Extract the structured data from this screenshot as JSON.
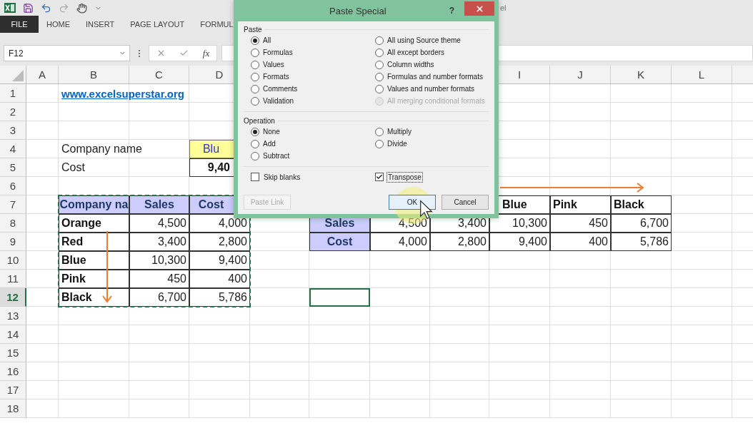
{
  "title_bar": {
    "title_fragment": "el"
  },
  "ribbon_tabs": [
    {
      "label": "FILE",
      "kind": "file"
    },
    {
      "label": "HOME",
      "kind": "tab"
    },
    {
      "label": "INSERT",
      "kind": "tab"
    },
    {
      "label": "PAGE LAYOUT",
      "kind": "tab"
    },
    {
      "label": "FORMUL",
      "kind": "tab"
    }
  ],
  "formula_bar": {
    "name_box": "F12",
    "function_label": "fx"
  },
  "sheet": {
    "columns": [
      "A",
      "B",
      "C",
      "D",
      null,
      null,
      null,
      null,
      "I",
      "J",
      "K",
      "L"
    ],
    "rows": [
      {
        "header": "1",
        "selected": false,
        "cells": [
          null,
          {
            "text": "www.excelsuperstar.org",
            "kind": "link"
          }
        ]
      },
      {
        "header": "2",
        "selected": false,
        "cells": []
      },
      {
        "header": "3",
        "selected": false,
        "cells": []
      },
      {
        "header": "4",
        "selected": false,
        "cells": [
          null,
          {
            "text": "Company name",
            "kind": "label"
          },
          null,
          {
            "text": "Blu",
            "kind": "input"
          }
        ]
      },
      {
        "header": "5",
        "selected": false,
        "cells": [
          null,
          {
            "text": "Cost",
            "kind": "label"
          },
          null,
          {
            "text": "9,40",
            "kind": "total"
          }
        ]
      },
      {
        "header": "6",
        "selected": false,
        "cells": []
      },
      {
        "header": "7",
        "selected": false,
        "cells": [
          null,
          {
            "text": "Company na",
            "kind": "header",
            "copied": true
          },
          {
            "text": "Sales",
            "kind": "header",
            "copied": true
          },
          {
            "text": "Cost",
            "kind": "header",
            "copied": true
          },
          null,
          null,
          null,
          null,
          {
            "text": "Blue",
            "kind": "name"
          },
          {
            "text": "Pink",
            "kind": "name"
          },
          {
            "text": "Black",
            "kind": "name"
          }
        ]
      },
      {
        "header": "8",
        "selected": false,
        "cells": [
          null,
          {
            "text": "Orange",
            "kind": "name",
            "copied": true
          },
          {
            "text": "4,500",
            "kind": "number",
            "copied": true
          },
          {
            "text": "4,000",
            "kind": "number",
            "copied": true
          },
          null,
          {
            "text": "Sales",
            "kind": "header"
          },
          {
            "text": "4,500",
            "kind": "number"
          },
          {
            "text": "3,400",
            "kind": "number"
          },
          {
            "text": "10,300",
            "kind": "number"
          },
          {
            "text": "450",
            "kind": "number"
          },
          {
            "text": "6,700",
            "kind": "number"
          }
        ]
      },
      {
        "header": "9",
        "selected": false,
        "cells": [
          null,
          {
            "text": "Red",
            "kind": "name",
            "copied": true
          },
          {
            "text": "3,400",
            "kind": "number",
            "copied": true
          },
          {
            "text": "2,800",
            "kind": "number",
            "copied": true
          },
          null,
          {
            "text": "Cost",
            "kind": "header"
          },
          {
            "text": "4,000",
            "kind": "number"
          },
          {
            "text": "2,800",
            "kind": "number"
          },
          {
            "text": "9,400",
            "kind": "number"
          },
          {
            "text": "400",
            "kind": "number"
          },
          {
            "text": "5,786",
            "kind": "number"
          }
        ]
      },
      {
        "header": "10",
        "selected": false,
        "cells": [
          null,
          {
            "text": "Blue",
            "kind": "name",
            "copied": true
          },
          {
            "text": "10,300",
            "kind": "number",
            "copied": true
          },
          {
            "text": "9,400",
            "kind": "number",
            "copied": true
          }
        ]
      },
      {
        "header": "11",
        "selected": false,
        "cells": [
          null,
          {
            "text": "Pink",
            "kind": "name",
            "copied": true
          },
          {
            "text": "450",
            "kind": "number",
            "copied": true
          },
          {
            "text": "400",
            "kind": "number",
            "copied": true
          }
        ]
      },
      {
        "header": "12",
        "selected": true,
        "cells": [
          null,
          {
            "text": "Black",
            "kind": "name",
            "copied": true
          },
          {
            "text": "6,700",
            "kind": "number",
            "copied": true
          },
          {
            "text": "5,786",
            "kind": "number",
            "copied": true
          },
          null,
          {
            "kind": "empty",
            "selected": true
          }
        ]
      },
      {
        "header": "13",
        "selected": false,
        "cells": []
      },
      {
        "header": "14",
        "selected": false,
        "cells": []
      },
      {
        "header": "15",
        "selected": false,
        "cells": []
      },
      {
        "header": "16",
        "selected": false,
        "cells": []
      },
      {
        "header": "17",
        "selected": false,
        "cells": []
      },
      {
        "header": "18",
        "selected": false,
        "cells": []
      }
    ]
  },
  "dialog": {
    "title": "Paste Special",
    "help": "?",
    "paste_label": "Paste",
    "paste_options": [
      {
        "label": "All",
        "selected": true,
        "disabled": false
      },
      {
        "label": "Formulas",
        "selected": false,
        "disabled": false
      },
      {
        "label": "Values",
        "selected": false,
        "disabled": false
      },
      {
        "label": "Formats",
        "selected": false,
        "disabled": false
      },
      {
        "label": "Comments",
        "selected": false,
        "disabled": false
      },
      {
        "label": "Validation",
        "selected": false,
        "disabled": false
      },
      {
        "label": "All using Source theme",
        "selected": false,
        "disabled": false
      },
      {
        "label": "All except borders",
        "selected": false,
        "disabled": false
      },
      {
        "label": "Column widths",
        "selected": false,
        "disabled": false
      },
      {
        "label": "Formulas and number formats",
        "selected": false,
        "disabled": false
      },
      {
        "label": "Values and number formats",
        "selected": false,
        "disabled": false
      },
      {
        "label": "All merging conditional formats",
        "selected": false,
        "disabled": true
      }
    ],
    "operation_label": "Operation",
    "operation_options": [
      {
        "label": "None",
        "selected": true
      },
      {
        "label": "Add",
        "selected": false
      },
      {
        "label": "Subtract",
        "selected": false
      },
      {
        "label": "Multiply",
        "selected": false
      },
      {
        "label": "Divide",
        "selected": false
      }
    ],
    "checkboxes": [
      {
        "label": "Skip blanks",
        "checked": false,
        "focused": false
      },
      {
        "label": "Transpose",
        "checked": true,
        "focused": true
      }
    ],
    "buttons": [
      {
        "label": "Paste Link",
        "disabled": true,
        "default": false
      },
      {
        "label": "OK",
        "disabled": false,
        "default": true
      },
      {
        "label": "Cancel",
        "disabled": false,
        "default": false
      }
    ]
  }
}
